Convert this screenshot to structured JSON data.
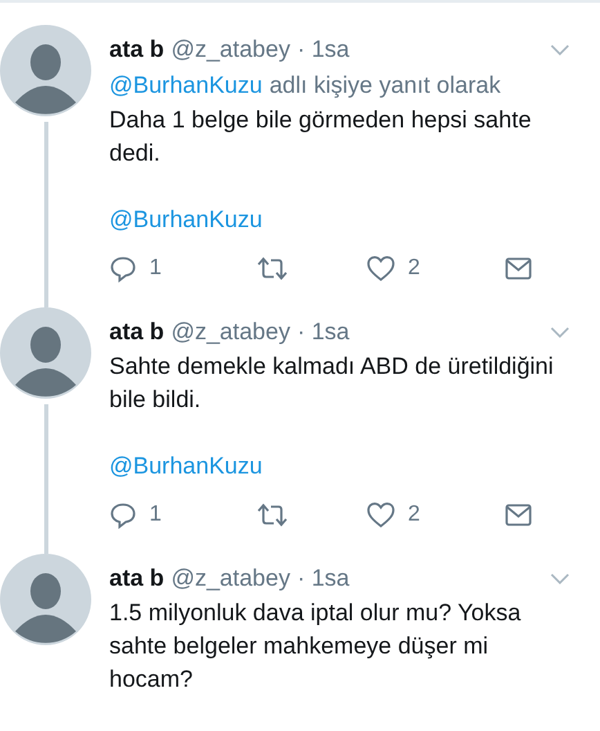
{
  "tweets": [
    {
      "name": "ata b",
      "handle": "@z_atabey",
      "time": "· 1sa",
      "reply_to": {
        "mention": "@BurhanKuzu",
        "text": "adlı kişiye yanıt olarak"
      },
      "body": "Daha 1 belge bile görmeden hepsi sahte dedi.",
      "mention": "@BurhanKuzu",
      "actions": {
        "replies": "1",
        "likes": "2"
      },
      "thread_continues": true
    },
    {
      "name": "ata b",
      "handle": "@z_atabey",
      "time": "· 1sa",
      "body": "Sahte demekle kalmadı ABD de üretildiğini bile bildi.",
      "mention": "@BurhanKuzu",
      "actions": {
        "replies": "1",
        "likes": "2"
      },
      "thread_continues": true
    },
    {
      "name": "ata b",
      "handle": "@z_atabey",
      "time": "· 1sa",
      "body": "1.5 milyonluk dava iptal olur mu? Yoksa sahte belgeler mahkemeye düşer mi hocam?",
      "thread_continues": false
    }
  ]
}
